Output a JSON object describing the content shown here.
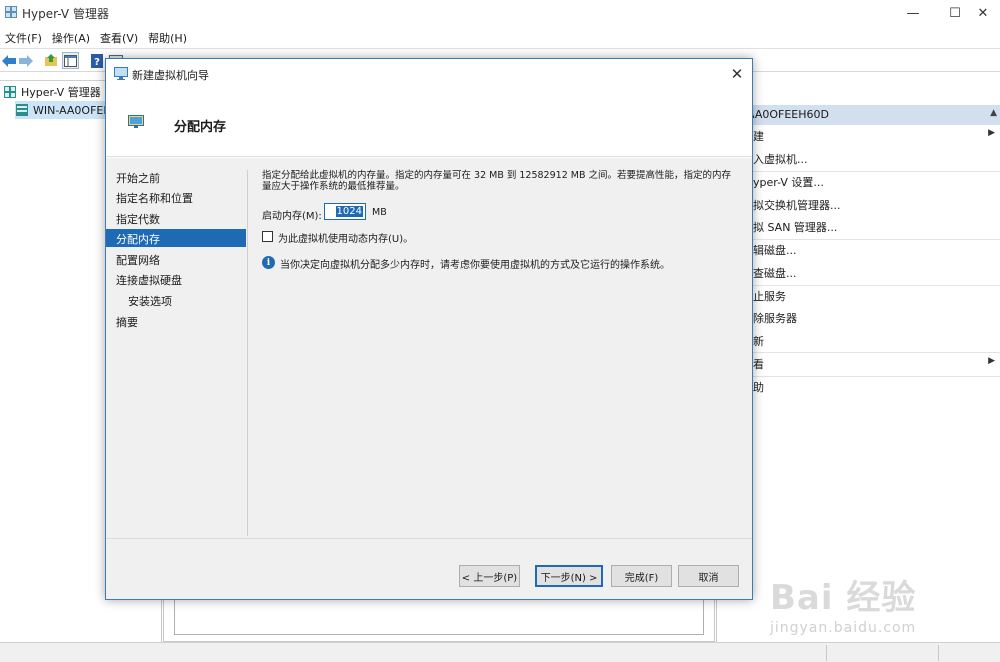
{
  "window": {
    "title": "Hyper-V 管理器",
    "controls": {
      "minimize": "—",
      "maximize": "☐",
      "close": "✕"
    }
  },
  "menubar": {
    "items": [
      {
        "label": "文件(F)"
      },
      {
        "label": "操作(A)"
      },
      {
        "label": "查看(V)"
      },
      {
        "label": "帮助(H)"
      }
    ]
  },
  "toolbar": {
    "icons": [
      "back-arrow-icon",
      "forward-arrow-icon",
      "up-folder-icon",
      "show-hide-tree-icon",
      "help-icon",
      "properties-icon"
    ]
  },
  "tree": {
    "root_label": "Hyper-V 管理器",
    "server_label": "WIN-AA0OFEE"
  },
  "actions": {
    "header": "AA0OFEEH60D",
    "items": [
      {
        "label": "建",
        "has_submenu": true
      },
      {
        "label": "入虚拟机..."
      },
      {
        "label": "yper-V 设置..."
      },
      {
        "label": "拟交换机管理器..."
      },
      {
        "label": "拟 SAN 管理器..."
      },
      {
        "label": "辑磁盘..."
      },
      {
        "label": "查磁盘..."
      },
      {
        "label": "止服务"
      },
      {
        "label": "除服务器"
      },
      {
        "label": "新"
      },
      {
        "label": "看",
        "has_submenu": true
      },
      {
        "label": "助"
      }
    ]
  },
  "dialog": {
    "title": "新建虚拟机向导",
    "close_symbol": "✕",
    "page_title": "分配内存",
    "steps": [
      {
        "label": "开始之前",
        "active": false,
        "sub": false
      },
      {
        "label": "指定名称和位置",
        "active": false,
        "sub": false
      },
      {
        "label": "指定代数",
        "active": false,
        "sub": false
      },
      {
        "label": "分配内存",
        "active": true,
        "sub": false
      },
      {
        "label": "配置网络",
        "active": false,
        "sub": false
      },
      {
        "label": "连接虚拟硬盘",
        "active": false,
        "sub": false
      },
      {
        "label": "安装选项",
        "active": false,
        "sub": true
      },
      {
        "label": "摘要",
        "active": false,
        "sub": false
      }
    ],
    "description": "指定分配给此虚拟机的内存量。指定的内存量可在 32 MB 到 12582912 MB 之间。若要提高性能，指定的内存量应大于操作系统的最低推荐量。",
    "startup_memory_label": "启动内存(M):",
    "startup_memory_value": "1024",
    "startup_memory_unit": "MB",
    "dynamic_memory_label": "为此虚拟机使用动态内存(U)。",
    "dynamic_memory_checked": false,
    "info_symbol": "i",
    "info_text": "当你决定向虚拟机分配多少内存时，请考虑你要使用虚拟机的方式及它运行的操作系统。",
    "buttons": {
      "previous": "< 上一步(P)",
      "next": "下一步(N) >",
      "finish": "完成(F)",
      "cancel": "取消"
    }
  },
  "watermark": {
    "logo_text": "Bai 经验",
    "sub_text": "jingyan.baidu.com"
  },
  "colors": {
    "accent": "#1e6ab4",
    "actions_header": "#d2dfee",
    "dialog_body": "#f0f0f0"
  }
}
